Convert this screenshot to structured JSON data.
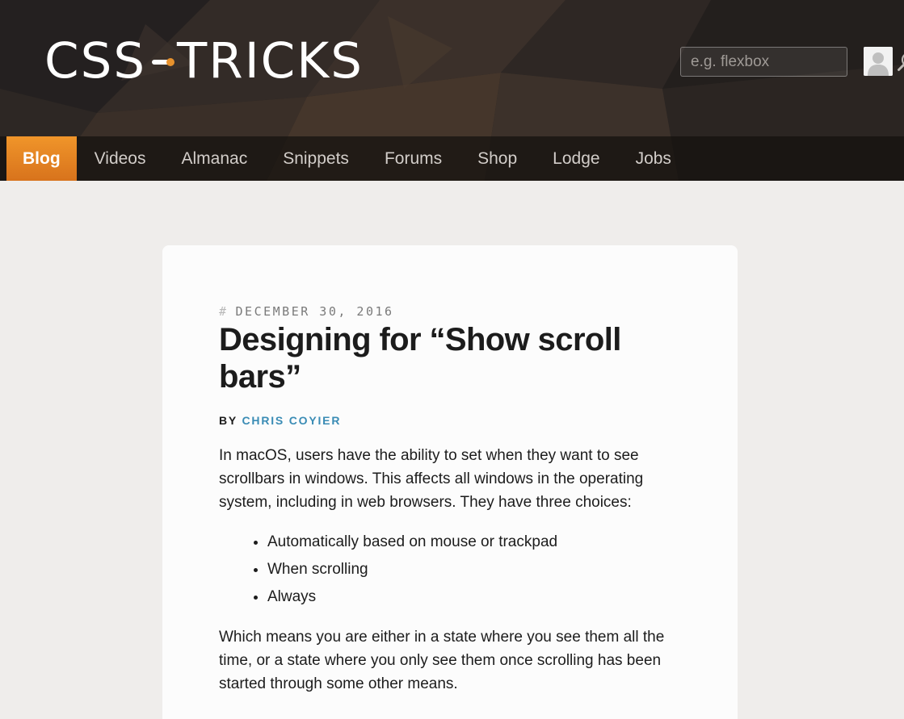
{
  "header": {
    "logo_left": "CSS",
    "logo_right": "TRICKS",
    "search_placeholder": "e.g. flexbox",
    "nav": [
      {
        "label": "Blog"
      },
      {
        "label": "Videos"
      },
      {
        "label": "Almanac"
      },
      {
        "label": "Snippets"
      },
      {
        "label": "Forums"
      },
      {
        "label": "Shop"
      },
      {
        "label": "Lodge"
      },
      {
        "label": "Jobs"
      }
    ],
    "active_nav": "Blog",
    "accent_color": "#e8922d"
  },
  "article": {
    "date_hash": "#",
    "date": "DECEMBER 30, 2016",
    "title": "Designing for “Show scroll bars”",
    "byline_prefix": "BY",
    "author": "CHRIS COYIER",
    "author_color": "#3a8cb5",
    "intro": "In macOS, users have the ability to set when they want to see scrollbars in windows. This affects all windows in the operating system, including in web browsers. They have three choices:",
    "choices": [
      "Automatically based on mouse or trackpad",
      "When scrolling",
      "Always"
    ],
    "followup": "Which means you are either in a state where you see them all the time, or a state where you only see them once scrolling has been started through some other means."
  }
}
